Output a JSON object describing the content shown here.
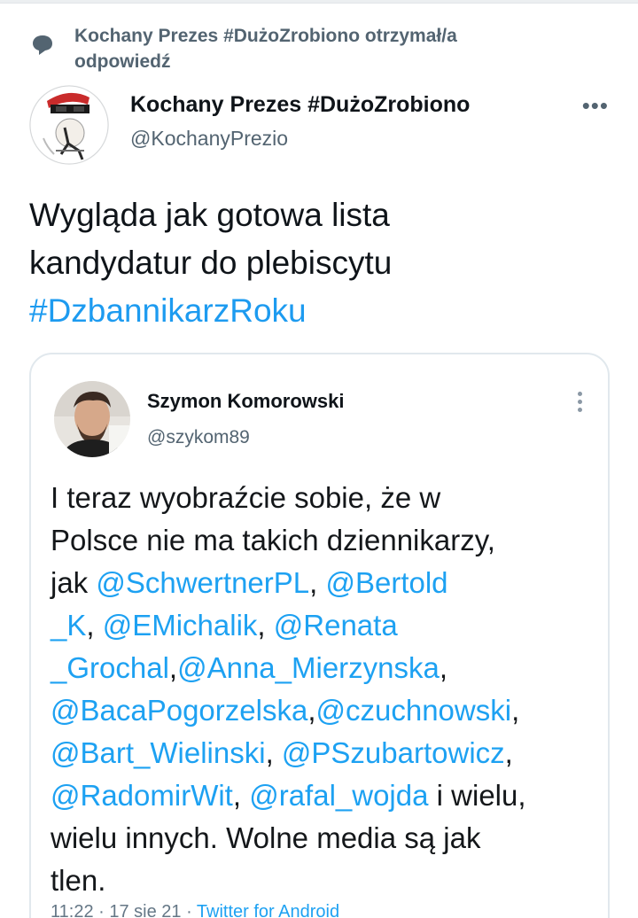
{
  "reply_banner": {
    "text_line1": "Kochany Prezes #DużoZrobiono otrzymał/a",
    "text_line2": "odpowiedź"
  },
  "author": {
    "name": "Kochany Prezes #DużoZrobiono",
    "handle": "@KochanyPrezio",
    "more_label": "•••"
  },
  "tweet": {
    "line1": "Wygląda jak gotowa lista",
    "line2": "kandydatur do plebiscytu",
    "hashtag": "#DzbannikarzRoku"
  },
  "quoted": {
    "name": "Szymon Komorowski",
    "handle": "@szykom89",
    "lines": [
      {
        "a": "I teraz wyobraźcie sobie, że w"
      },
      {
        "a": "Polsce nie ma takich dziennikarzy,"
      },
      {
        "a": "jak ",
        "m1": "@SchwertnerPL",
        "b": ", ",
        "m2": "@Bertold"
      },
      {
        "m1": "_K",
        "b": ", ",
        "m2": "@EMichalik",
        "c": ", ",
        "m3": "@Renata"
      },
      {
        "m1": "_Grochal",
        "b": ",",
        "m2": "@Anna_Mierzynska",
        "c": ","
      },
      {
        "m1": "@BacaPogorzelska",
        "b": ",",
        "m2": "@czuchnowski",
        "c": ","
      },
      {
        "m1": "@Bart_Wielinski",
        "b": ", ",
        "m2": "@PSzubartowicz",
        "c": ","
      },
      {
        "m1": "@RadomirWit",
        "b": ", ",
        "m2": "@rafal_wojda",
        "c": " i wielu,"
      },
      {
        "a": "wielu innych. Wolne media są jak"
      },
      {
        "a": "tlen."
      }
    ],
    "meta_time": "11:22 · 17 sie 21 · ",
    "meta_source": "Twitter for Android"
  },
  "colors": {
    "link": "#1d9bf0",
    "muted": "#536471",
    "text": "#0f1419"
  }
}
